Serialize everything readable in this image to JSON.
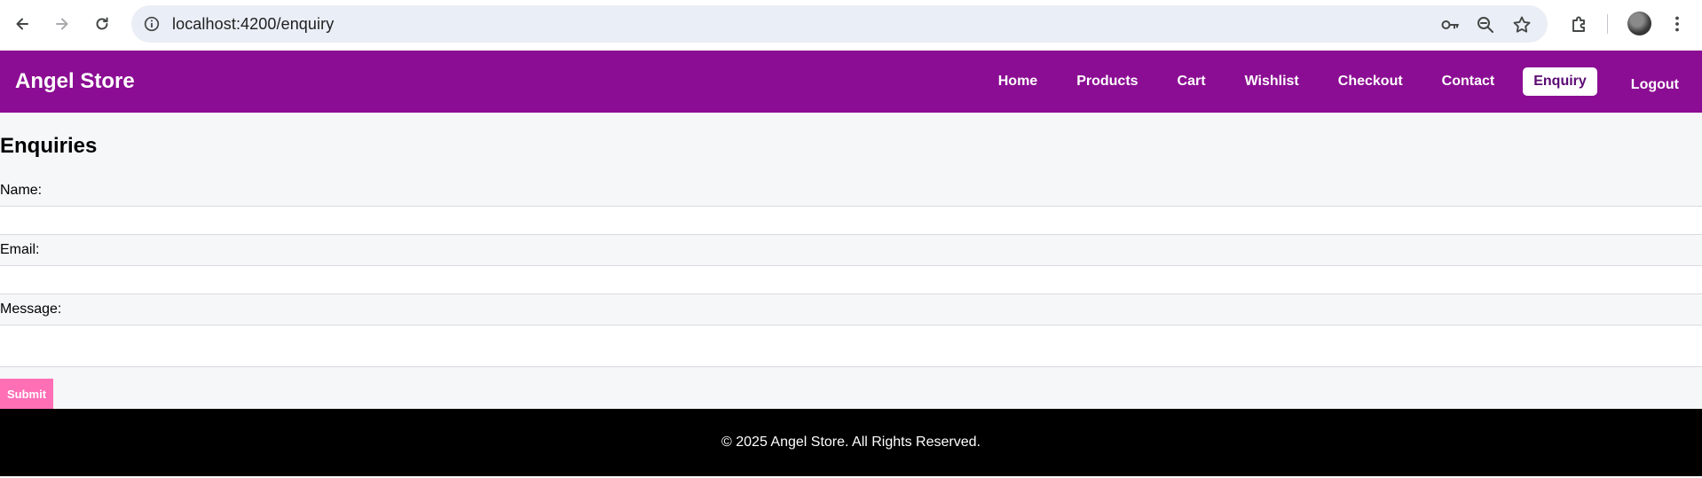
{
  "browser": {
    "url": "localhost:4200/enquiry",
    "icons": {
      "back": "arrow-left-icon",
      "forward": "arrow-right-icon",
      "reload": "reload-icon",
      "site_info": "info-icon",
      "password": "key-icon",
      "zoom": "zoom-out-icon",
      "bookmark": "star-icon",
      "extensions": "puzzle-icon",
      "menu": "kebab-menu-icon"
    }
  },
  "navbar": {
    "brand": "Angel Store",
    "links": [
      {
        "label": "Home"
      },
      {
        "label": "Products"
      },
      {
        "label": "Cart"
      },
      {
        "label": "Wishlist"
      },
      {
        "label": "Checkout"
      },
      {
        "label": "Contact"
      },
      {
        "label": "Enquiry",
        "active": true
      },
      {
        "label": "Logout"
      }
    ]
  },
  "form": {
    "title": "Enquiries",
    "name_label": "Name:",
    "name_value": "",
    "email_label": "Email:",
    "email_value": "",
    "message_label": "Message:",
    "message_value": "",
    "submit_label": "Submit"
  },
  "footer": {
    "text": "© 2025 Angel Store. All Rights Reserved."
  },
  "colors": {
    "nav_bg": "#8b0d93",
    "active_link_text": "#5b0a73",
    "submit_bg": "#ff6fb6",
    "page_bg": "#f6f7f9",
    "footer_bg": "#000000"
  }
}
